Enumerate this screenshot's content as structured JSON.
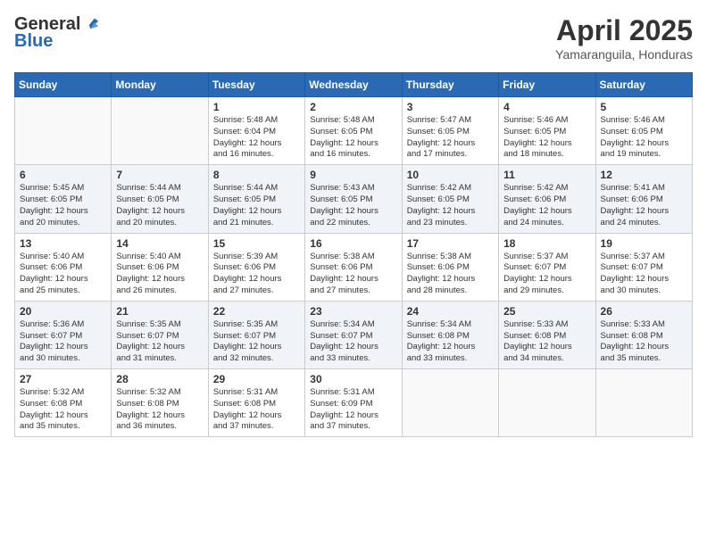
{
  "header": {
    "logo_general": "General",
    "logo_blue": "Blue",
    "month_title": "April 2025",
    "subtitle": "Yamaranguila, Honduras"
  },
  "weekdays": [
    "Sunday",
    "Monday",
    "Tuesday",
    "Wednesday",
    "Thursday",
    "Friday",
    "Saturday"
  ],
  "rows": [
    [
      {
        "day": "",
        "info": ""
      },
      {
        "day": "",
        "info": ""
      },
      {
        "day": "1",
        "info": "Sunrise: 5:48 AM\nSunset: 6:04 PM\nDaylight: 12 hours\nand 16 minutes."
      },
      {
        "day": "2",
        "info": "Sunrise: 5:48 AM\nSunset: 6:05 PM\nDaylight: 12 hours\nand 16 minutes."
      },
      {
        "day": "3",
        "info": "Sunrise: 5:47 AM\nSunset: 6:05 PM\nDaylight: 12 hours\nand 17 minutes."
      },
      {
        "day": "4",
        "info": "Sunrise: 5:46 AM\nSunset: 6:05 PM\nDaylight: 12 hours\nand 18 minutes."
      },
      {
        "day": "5",
        "info": "Sunrise: 5:46 AM\nSunset: 6:05 PM\nDaylight: 12 hours\nand 19 minutes."
      }
    ],
    [
      {
        "day": "6",
        "info": "Sunrise: 5:45 AM\nSunset: 6:05 PM\nDaylight: 12 hours\nand 20 minutes."
      },
      {
        "day": "7",
        "info": "Sunrise: 5:44 AM\nSunset: 6:05 PM\nDaylight: 12 hours\nand 20 minutes."
      },
      {
        "day": "8",
        "info": "Sunrise: 5:44 AM\nSunset: 6:05 PM\nDaylight: 12 hours\nand 21 minutes."
      },
      {
        "day": "9",
        "info": "Sunrise: 5:43 AM\nSunset: 6:05 PM\nDaylight: 12 hours\nand 22 minutes."
      },
      {
        "day": "10",
        "info": "Sunrise: 5:42 AM\nSunset: 6:05 PM\nDaylight: 12 hours\nand 23 minutes."
      },
      {
        "day": "11",
        "info": "Sunrise: 5:42 AM\nSunset: 6:06 PM\nDaylight: 12 hours\nand 24 minutes."
      },
      {
        "day": "12",
        "info": "Sunrise: 5:41 AM\nSunset: 6:06 PM\nDaylight: 12 hours\nand 24 minutes."
      }
    ],
    [
      {
        "day": "13",
        "info": "Sunrise: 5:40 AM\nSunset: 6:06 PM\nDaylight: 12 hours\nand 25 minutes."
      },
      {
        "day": "14",
        "info": "Sunrise: 5:40 AM\nSunset: 6:06 PM\nDaylight: 12 hours\nand 26 minutes."
      },
      {
        "day": "15",
        "info": "Sunrise: 5:39 AM\nSunset: 6:06 PM\nDaylight: 12 hours\nand 27 minutes."
      },
      {
        "day": "16",
        "info": "Sunrise: 5:38 AM\nSunset: 6:06 PM\nDaylight: 12 hours\nand 27 minutes."
      },
      {
        "day": "17",
        "info": "Sunrise: 5:38 AM\nSunset: 6:06 PM\nDaylight: 12 hours\nand 28 minutes."
      },
      {
        "day": "18",
        "info": "Sunrise: 5:37 AM\nSunset: 6:07 PM\nDaylight: 12 hours\nand 29 minutes."
      },
      {
        "day": "19",
        "info": "Sunrise: 5:37 AM\nSunset: 6:07 PM\nDaylight: 12 hours\nand 30 minutes."
      }
    ],
    [
      {
        "day": "20",
        "info": "Sunrise: 5:36 AM\nSunset: 6:07 PM\nDaylight: 12 hours\nand 30 minutes."
      },
      {
        "day": "21",
        "info": "Sunrise: 5:35 AM\nSunset: 6:07 PM\nDaylight: 12 hours\nand 31 minutes."
      },
      {
        "day": "22",
        "info": "Sunrise: 5:35 AM\nSunset: 6:07 PM\nDaylight: 12 hours\nand 32 minutes."
      },
      {
        "day": "23",
        "info": "Sunrise: 5:34 AM\nSunset: 6:07 PM\nDaylight: 12 hours\nand 33 minutes."
      },
      {
        "day": "24",
        "info": "Sunrise: 5:34 AM\nSunset: 6:08 PM\nDaylight: 12 hours\nand 33 minutes."
      },
      {
        "day": "25",
        "info": "Sunrise: 5:33 AM\nSunset: 6:08 PM\nDaylight: 12 hours\nand 34 minutes."
      },
      {
        "day": "26",
        "info": "Sunrise: 5:33 AM\nSunset: 6:08 PM\nDaylight: 12 hours\nand 35 minutes."
      }
    ],
    [
      {
        "day": "27",
        "info": "Sunrise: 5:32 AM\nSunset: 6:08 PM\nDaylight: 12 hours\nand 35 minutes."
      },
      {
        "day": "28",
        "info": "Sunrise: 5:32 AM\nSunset: 6:08 PM\nDaylight: 12 hours\nand 36 minutes."
      },
      {
        "day": "29",
        "info": "Sunrise: 5:31 AM\nSunset: 6:08 PM\nDaylight: 12 hours\nand 37 minutes."
      },
      {
        "day": "30",
        "info": "Sunrise: 5:31 AM\nSunset: 6:09 PM\nDaylight: 12 hours\nand 37 minutes."
      },
      {
        "day": "",
        "info": ""
      },
      {
        "day": "",
        "info": ""
      },
      {
        "day": "",
        "info": ""
      }
    ]
  ]
}
